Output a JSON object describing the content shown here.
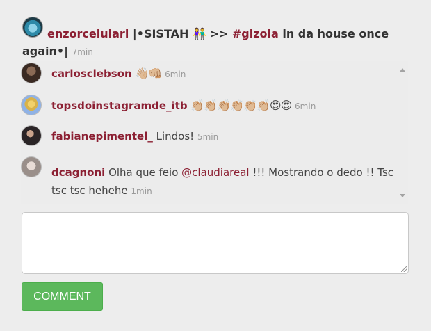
{
  "post": {
    "username": "enzorcelulari",
    "text_before": " |•SISTAH ",
    "emoji": "👫",
    "text_mid": " >> ",
    "hashtag": "#gizola",
    "text_after": " in da house once again•| ",
    "time": "7min"
  },
  "comments": [
    {
      "username": "carlosclebson",
      "emoji": "👋🏼👊🏼",
      "text": "",
      "time": "6min",
      "avatar_color": "#5b4636"
    },
    {
      "username": "topsdoinstagramde_itb",
      "emoji": "👏🏼👏🏼👏🏼👏🏼👏🏼👏🏼😍😍",
      "text": "",
      "time": "6min",
      "avatar_color": "#7aa0d8"
    },
    {
      "username": "fabianepimentel_",
      "emoji": "",
      "text": " Lindos! ",
      "time": "5min",
      "avatar_color": "#2a2426"
    },
    {
      "username": "dcagnoni",
      "text_before": " Olha que feio ",
      "mention": "@claudiareal",
      "text_after": " !!! Mostrando o dedo !! Tsc tsc tsc hehehe ",
      "time": "1min",
      "avatar_color": "#b9b1ad"
    }
  ],
  "comment_input": {
    "value": "",
    "placeholder": ""
  },
  "comment_button": {
    "label": "COMMENT",
    "color": "#5cb85c"
  }
}
